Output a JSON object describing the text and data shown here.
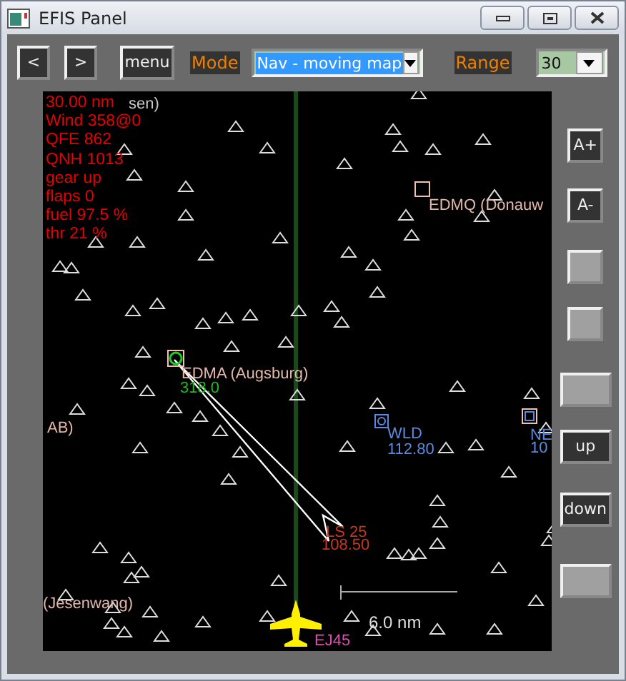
{
  "window": {
    "title": "EFIS Panel"
  },
  "toolbar": {
    "prev_button": "<",
    "next_button": ">",
    "menu_button": "menu",
    "mode_label": "Mode",
    "mode_select": {
      "value": "Nav - moving map",
      "highlighted": true
    },
    "range_label": "Range",
    "range_select": {
      "value": "30",
      "highlighted": false
    }
  },
  "map": {
    "status_lines": [
      "30.00 nm",
      "Wind 358@0",
      "QFE 862",
      "QNH 1013",
      "gear up",
      "flaps 0",
      "fuel 97.5 %",
      "thr 21 %"
    ],
    "labels": [
      {
        "text": "sen)",
        "kind": "faded"
      },
      {
        "text": "EDMQ (Donauw",
        "kind": "airport"
      },
      {
        "text": "EDMA (Augsburg)",
        "kind": "airport"
      },
      {
        "text": "318.0",
        "kind": "ndb"
      },
      {
        "text": "AB)",
        "kind": "airport"
      },
      {
        "text": "WLD",
        "kind": "vor"
      },
      {
        "text": "112.80",
        "kind": "vor"
      },
      {
        "text": "LS 25",
        "kind": "ils"
      },
      {
        "text": "108.50",
        "kind": "ils"
      },
      {
        "text": "NE",
        "kind": "vor"
      },
      {
        "text": "10",
        "kind": "vor"
      },
      {
        "text": "(Jesenwang)",
        "kind": "airport"
      },
      {
        "text": "EJ45",
        "kind": "aircraft"
      }
    ],
    "scale": "6.0 nm"
  },
  "side_buttons": [
    {
      "kind": "text",
      "label": "A+",
      "wide": false
    },
    {
      "kind": "text",
      "label": "A-",
      "wide": false
    },
    {
      "kind": "blank",
      "wide": false
    },
    {
      "kind": "blank",
      "wide": false
    },
    {
      "kind": "blank",
      "wide": true
    },
    {
      "kind": "text",
      "label": "up",
      "wide": true
    },
    {
      "kind": "text",
      "label": "down",
      "wide": true
    },
    {
      "kind": "blank",
      "wide": true
    }
  ]
}
